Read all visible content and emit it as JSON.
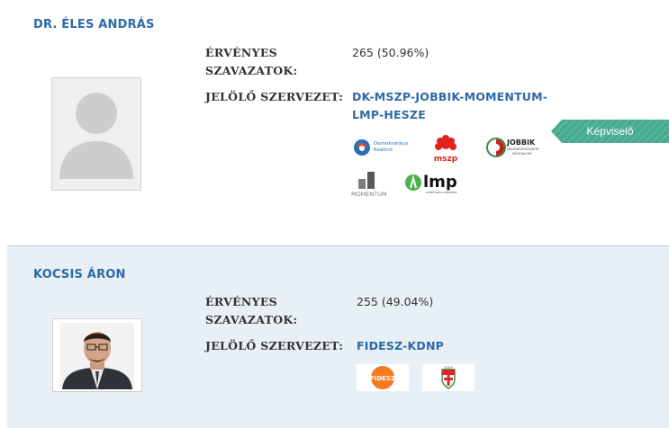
{
  "candidates": [
    {
      "name": "DR. ÉLES ANDRÁS",
      "votes_label_line1": "ÉRVÉNYES",
      "votes_label_line2": "SZAVAZATOK:",
      "votes_value": "265 (50.96%)",
      "org_label": "JELÖLŐ SZERVEZET:",
      "org_line1": "DK-MSZP-JOBBIK-MOMENTUM-",
      "org_line2": "LMP-HESZE",
      "badge": "Képviselő",
      "logos": [
        {
          "name": "dk-logo",
          "text_a": "Demokratikus",
          "text_b": "Koalíció"
        },
        {
          "name": "mszp-logo",
          "text": "mszp"
        },
        {
          "name": "jobbik-logo",
          "text_a": "JOBBIK",
          "text_b": "MAGYARORSZÁGÉRT",
          "text_c": "MOZGALOM"
        },
        {
          "name": "momentum-logo",
          "text": "MOMENTUM"
        },
        {
          "name": "lmp-logo",
          "text": "lmp",
          "text_b": "LEHET MÁS A POLITIKA"
        }
      ]
    },
    {
      "name": "KOCSIS ÁRON",
      "votes_label_line1": "ÉRVÉNYES",
      "votes_label_line2": "SZAVAZATOK:",
      "votes_value": "255 (49.04%)",
      "org_label": "JELÖLŐ SZERVEZET:",
      "org_line1": "FIDESZ-KDNP",
      "logos": [
        {
          "name": "fidesz-logo",
          "text": "FIDESZ"
        },
        {
          "name": "kdnp-logo",
          "text": "KDNP"
        }
      ]
    }
  ],
  "colors": {
    "link": "#2c6aa8",
    "badge": "#4caf93",
    "card_bg": "#e8f0f5"
  }
}
